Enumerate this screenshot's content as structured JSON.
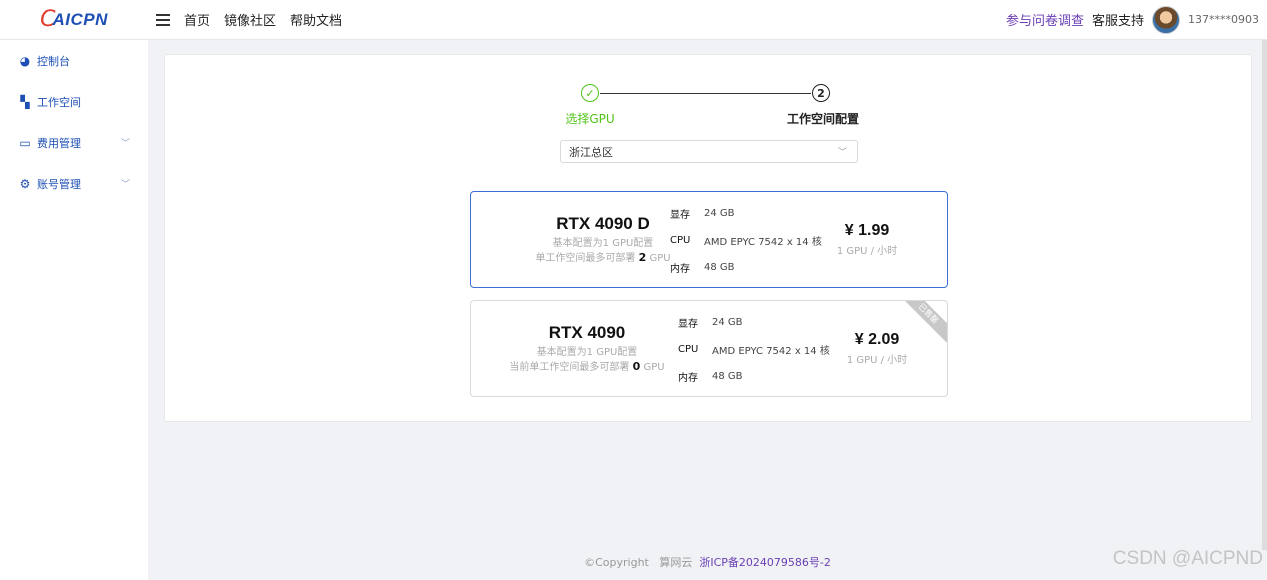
{
  "header": {
    "logo_text": "AICPN",
    "nav": [
      "首页",
      "镜像社区",
      "帮助文档"
    ],
    "survey_link": "参与问卷调查",
    "support_link": "客服支持",
    "phone": "137****0903"
  },
  "sidebar": {
    "items": [
      {
        "label": "控制台",
        "icon": "dashboard-icon"
      },
      {
        "label": "工作空间",
        "icon": "workspace-icon"
      },
      {
        "label": "费用管理",
        "icon": "billing-icon",
        "expandable": true
      },
      {
        "label": "账号管理",
        "icon": "gear-icon",
        "expandable": true
      }
    ]
  },
  "steps": {
    "step1_label": "选择GPU",
    "step2_number": "2",
    "step2_label": "工作空间配置"
  },
  "region_select": {
    "value": "浙江总区"
  },
  "gpu_cards": [
    {
      "name": "RTX 4090 D",
      "sub1": "基本配置为1 GPU配置",
      "sub2_prefix": "单工作空间最多可部署",
      "sub2_count": "2",
      "sub2_suffix": "GPU",
      "vram_key": "显存",
      "vram": "24 GB",
      "cpu_key": "CPU",
      "cpu": "AMD EPYC 7542 x 14 核",
      "mem_key": "内存",
      "mem": "48 GB",
      "price": "¥ 1.99",
      "price_unit": "1 GPU / 小时",
      "selected": true
    },
    {
      "name": "RTX 4090",
      "sub1": "基本配置为1 GPU配置",
      "sub2_prefix": "当前单工作空间最多可部署",
      "sub2_count": "0",
      "sub2_suffix": "GPU",
      "vram_key": "显存",
      "vram": "24 GB",
      "cpu_key": "CPU",
      "cpu": "AMD EPYC 7542 x 14 核",
      "mem_key": "内存",
      "mem": "48 GB",
      "price": "¥ 2.09",
      "price_unit": "1 GPU / 小时",
      "ribbon": "已售罄",
      "selected": false
    }
  ],
  "footer": {
    "copyright": "©Copyright",
    "company": "算网云",
    "icp": "浙ICP备2024079586号-2"
  },
  "watermark": "CSDN @AICPND",
  "colors": {
    "brand": "#1d4fb4",
    "success": "#52c41a",
    "selected_border": "#3b6fd4"
  }
}
